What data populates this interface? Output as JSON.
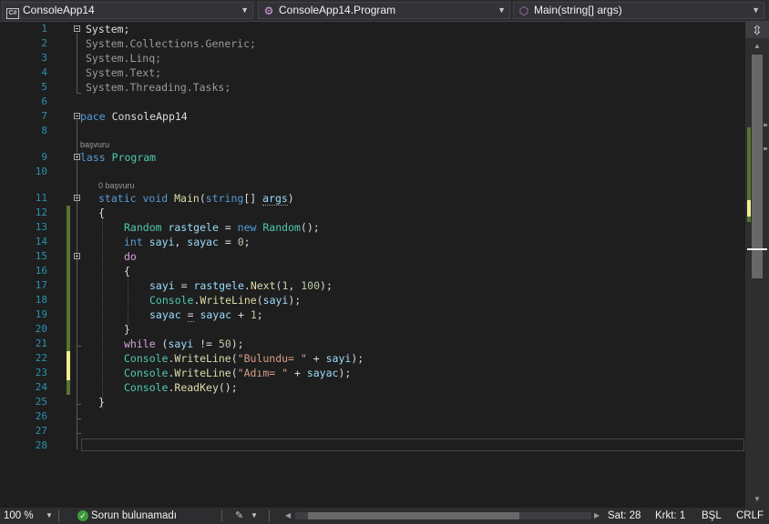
{
  "navbar": {
    "project": "ConsoleApp14",
    "type": "ConsoleApp14.Program",
    "member": "Main(string[] args)",
    "project_icon": "csharp-project-icon",
    "type_icon": "class-icon",
    "member_icon": "method-icon"
  },
  "code": {
    "lines": [
      {
        "n": "1",
        "text": "System;"
      },
      {
        "n": "2",
        "text": "System.Collections.Generic;"
      },
      {
        "n": "3",
        "text": "System.Linq;"
      },
      {
        "n": "4",
        "text": "System.Text;"
      },
      {
        "n": "5",
        "text": "System.Threading.Tasks;"
      },
      {
        "n": "6",
        "text": ""
      },
      {
        "n": "7",
        "text": "pace ConsoleApp14"
      },
      {
        "n": "8",
        "text": ""
      },
      {
        "n": "9",
        "text": "lass Program"
      },
      {
        "n": "10",
        "text": ""
      },
      {
        "n": "11",
        "text": "static void Main(string[] args)"
      },
      {
        "n": "12",
        "text": "{"
      },
      {
        "n": "13",
        "text": "Random rastgele = new Random();"
      },
      {
        "n": "14",
        "text": "int sayi, sayac = 0;"
      },
      {
        "n": "15",
        "text": "do"
      },
      {
        "n": "16",
        "text": "{"
      },
      {
        "n": "17",
        "text": "sayi = rastgele.Next(1, 100);"
      },
      {
        "n": "18",
        "text": "Console.WriteLine(sayi);"
      },
      {
        "n": "19",
        "text": "sayac = sayac + 1;"
      },
      {
        "n": "20",
        "text": "}"
      },
      {
        "n": "21",
        "text": "while (sayi != 50);"
      },
      {
        "n": "22",
        "text": "Console.WriteLine(\"Bulundu= \" + sayi);"
      },
      {
        "n": "23",
        "text": "Console.WriteLine(\"Adım= \" + sayac);"
      },
      {
        "n": "24",
        "text": "Console.ReadKey();"
      },
      {
        "n": "25",
        "text": "}"
      },
      {
        "n": "26",
        "text": ""
      },
      {
        "n": "27",
        "text": ""
      },
      {
        "n": "28",
        "text": ""
      }
    ],
    "codelens_class": "başvuru",
    "codelens_main": "0 başvuru"
  },
  "status": {
    "zoom": "100 %",
    "issues": "Sorun bulunamadı",
    "line": "Sat: 28",
    "col": "Krkt: 1",
    "mode": "BŞL",
    "eol": "CRLF"
  },
  "colors": {
    "keyword": "#569cd6",
    "control_keyword": "#d8a0df",
    "type": "#4ec9b0",
    "method": "#dcdcaa",
    "number": "#b5cea8",
    "string": "#d69d85",
    "parameter": "#9cdcfe",
    "line_number": "#2b91af",
    "saved_change": "#577430",
    "unsaved_change": "#efef91"
  }
}
